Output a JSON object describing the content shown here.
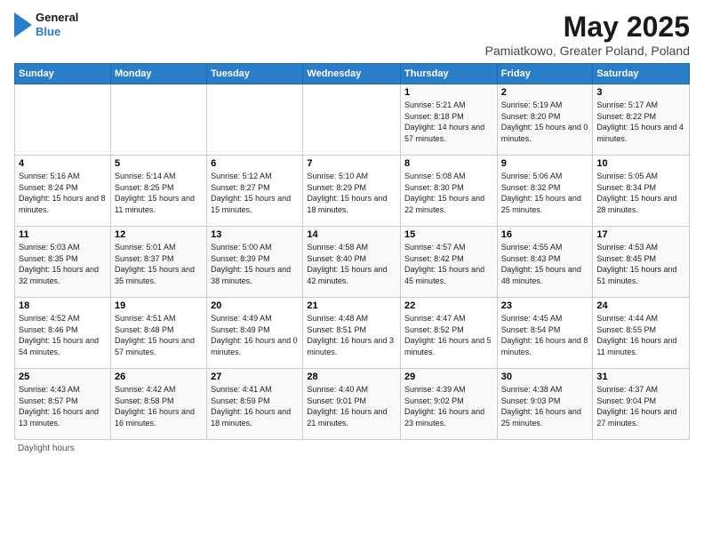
{
  "header": {
    "logo_line1": "General",
    "logo_line2": "Blue",
    "title": "May 2025",
    "subtitle": "Pamiatkowo, Greater Poland, Poland"
  },
  "days_of_week": [
    "Sunday",
    "Monday",
    "Tuesday",
    "Wednesday",
    "Thursday",
    "Friday",
    "Saturday"
  ],
  "weeks": [
    [
      {
        "day": "",
        "info": ""
      },
      {
        "day": "",
        "info": ""
      },
      {
        "day": "",
        "info": ""
      },
      {
        "day": "",
        "info": ""
      },
      {
        "day": "1",
        "info": "Sunrise: 5:21 AM\nSunset: 8:18 PM\nDaylight: 14 hours and 57 minutes."
      },
      {
        "day": "2",
        "info": "Sunrise: 5:19 AM\nSunset: 8:20 PM\nDaylight: 15 hours and 0 minutes."
      },
      {
        "day": "3",
        "info": "Sunrise: 5:17 AM\nSunset: 8:22 PM\nDaylight: 15 hours and 4 minutes."
      }
    ],
    [
      {
        "day": "4",
        "info": "Sunrise: 5:16 AM\nSunset: 8:24 PM\nDaylight: 15 hours and 8 minutes."
      },
      {
        "day": "5",
        "info": "Sunrise: 5:14 AM\nSunset: 8:25 PM\nDaylight: 15 hours and 11 minutes."
      },
      {
        "day": "6",
        "info": "Sunrise: 5:12 AM\nSunset: 8:27 PM\nDaylight: 15 hours and 15 minutes."
      },
      {
        "day": "7",
        "info": "Sunrise: 5:10 AM\nSunset: 8:29 PM\nDaylight: 15 hours and 18 minutes."
      },
      {
        "day": "8",
        "info": "Sunrise: 5:08 AM\nSunset: 8:30 PM\nDaylight: 15 hours and 22 minutes."
      },
      {
        "day": "9",
        "info": "Sunrise: 5:06 AM\nSunset: 8:32 PM\nDaylight: 15 hours and 25 minutes."
      },
      {
        "day": "10",
        "info": "Sunrise: 5:05 AM\nSunset: 8:34 PM\nDaylight: 15 hours and 28 minutes."
      }
    ],
    [
      {
        "day": "11",
        "info": "Sunrise: 5:03 AM\nSunset: 8:35 PM\nDaylight: 15 hours and 32 minutes."
      },
      {
        "day": "12",
        "info": "Sunrise: 5:01 AM\nSunset: 8:37 PM\nDaylight: 15 hours and 35 minutes."
      },
      {
        "day": "13",
        "info": "Sunrise: 5:00 AM\nSunset: 8:39 PM\nDaylight: 15 hours and 38 minutes."
      },
      {
        "day": "14",
        "info": "Sunrise: 4:58 AM\nSunset: 8:40 PM\nDaylight: 15 hours and 42 minutes."
      },
      {
        "day": "15",
        "info": "Sunrise: 4:57 AM\nSunset: 8:42 PM\nDaylight: 15 hours and 45 minutes."
      },
      {
        "day": "16",
        "info": "Sunrise: 4:55 AM\nSunset: 8:43 PM\nDaylight: 15 hours and 48 minutes."
      },
      {
        "day": "17",
        "info": "Sunrise: 4:53 AM\nSunset: 8:45 PM\nDaylight: 15 hours and 51 minutes."
      }
    ],
    [
      {
        "day": "18",
        "info": "Sunrise: 4:52 AM\nSunset: 8:46 PM\nDaylight: 15 hours and 54 minutes."
      },
      {
        "day": "19",
        "info": "Sunrise: 4:51 AM\nSunset: 8:48 PM\nDaylight: 15 hours and 57 minutes."
      },
      {
        "day": "20",
        "info": "Sunrise: 4:49 AM\nSunset: 8:49 PM\nDaylight: 16 hours and 0 minutes."
      },
      {
        "day": "21",
        "info": "Sunrise: 4:48 AM\nSunset: 8:51 PM\nDaylight: 16 hours and 3 minutes."
      },
      {
        "day": "22",
        "info": "Sunrise: 4:47 AM\nSunset: 8:52 PM\nDaylight: 16 hours and 5 minutes."
      },
      {
        "day": "23",
        "info": "Sunrise: 4:45 AM\nSunset: 8:54 PM\nDaylight: 16 hours and 8 minutes."
      },
      {
        "day": "24",
        "info": "Sunrise: 4:44 AM\nSunset: 8:55 PM\nDaylight: 16 hours and 11 minutes."
      }
    ],
    [
      {
        "day": "25",
        "info": "Sunrise: 4:43 AM\nSunset: 8:57 PM\nDaylight: 16 hours and 13 minutes."
      },
      {
        "day": "26",
        "info": "Sunrise: 4:42 AM\nSunset: 8:58 PM\nDaylight: 16 hours and 16 minutes."
      },
      {
        "day": "27",
        "info": "Sunrise: 4:41 AM\nSunset: 8:59 PM\nDaylight: 16 hours and 18 minutes."
      },
      {
        "day": "28",
        "info": "Sunrise: 4:40 AM\nSunset: 9:01 PM\nDaylight: 16 hours and 21 minutes."
      },
      {
        "day": "29",
        "info": "Sunrise: 4:39 AM\nSunset: 9:02 PM\nDaylight: 16 hours and 23 minutes."
      },
      {
        "day": "30",
        "info": "Sunrise: 4:38 AM\nSunset: 9:03 PM\nDaylight: 16 hours and 25 minutes."
      },
      {
        "day": "31",
        "info": "Sunrise: 4:37 AM\nSunset: 9:04 PM\nDaylight: 16 hours and 27 minutes."
      }
    ]
  ],
  "footer": {
    "note": "Daylight hours"
  }
}
